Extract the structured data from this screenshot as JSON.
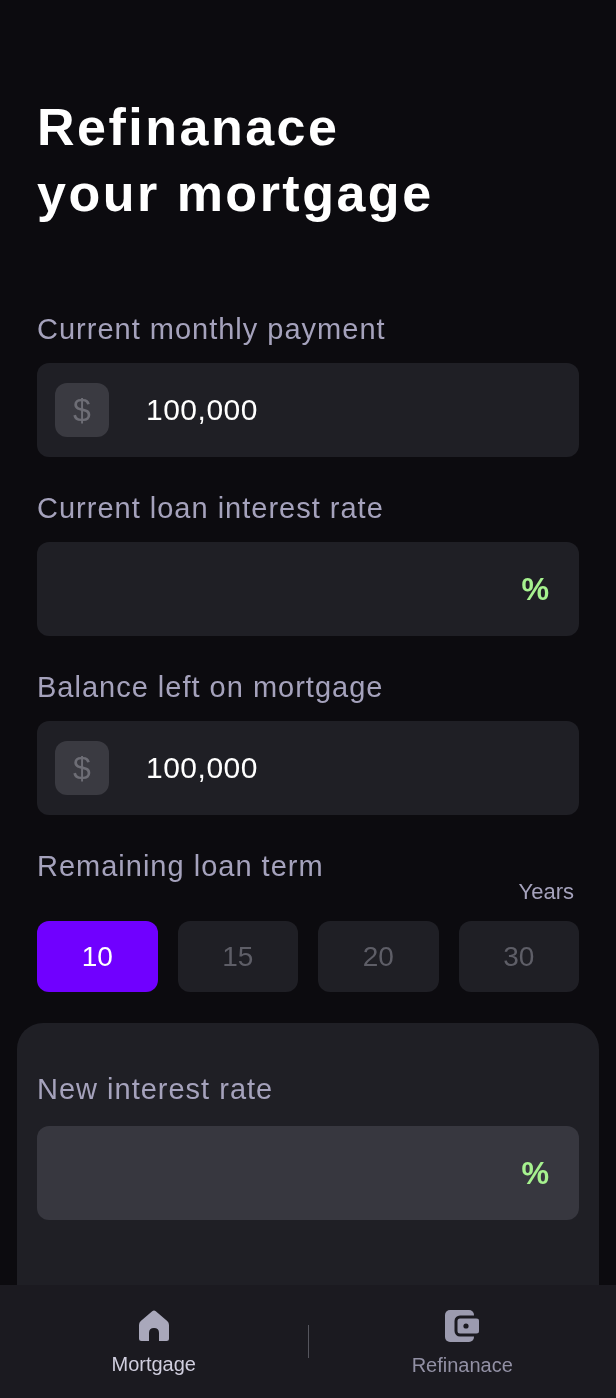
{
  "title": "Refinanace your mortgage",
  "fields": [
    {
      "label": "Current monthly payment",
      "kind": "currency",
      "prefix": "$",
      "value": "100,000"
    },
    {
      "label": "Current loan interest rate",
      "kind": "percent",
      "suffix": "%"
    },
    {
      "label": "Balance left on mortgage",
      "kind": "currency",
      "prefix": "$",
      "value": "100,000"
    }
  ],
  "loan_term": {
    "label": "Remaining loan term",
    "unit": "Years",
    "options": [
      {
        "label": "10",
        "selected": true
      },
      {
        "label": "15",
        "selected": false
      },
      {
        "label": "20",
        "selected": false
      },
      {
        "label": "30",
        "selected": false
      }
    ]
  },
  "new_rate_card": {
    "fields": [
      {
        "label": "New interest rate",
        "kind": "percent",
        "suffix": "%"
      }
    ]
  },
  "bottom_nav": {
    "items": [
      {
        "label": "Mortgage",
        "kind": "home",
        "selected": true
      },
      {
        "label": "Refinanace",
        "kind": "wallet",
        "selected": false
      }
    ]
  }
}
